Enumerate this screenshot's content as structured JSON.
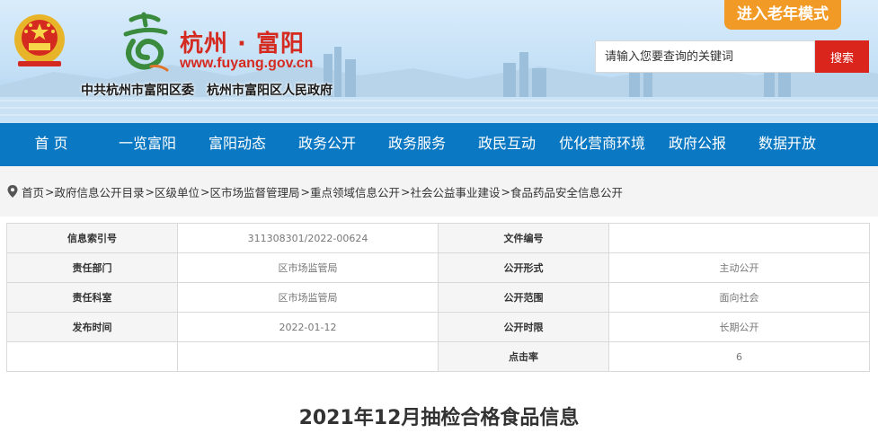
{
  "header": {
    "site_title": "杭州 · 富阳",
    "site_url": "www.fuyang.gov.cn",
    "logo_script_text": "富",
    "org_names": [
      "中共杭州市富阳区委",
      "杭州市富阳区人民政府"
    ],
    "elder_mode_label": "进入老年模式",
    "search_placeholder": "请输入您要查询的关键词",
    "search_button_label": "搜索",
    "colors": {
      "title_red": "#d52a20",
      "elder_orange": "#f19a25",
      "search_red": "#d9251c"
    }
  },
  "nav": {
    "color": "#0a78c2",
    "items": [
      {
        "label": "首 页"
      },
      {
        "label": "一览富阳"
      },
      {
        "label": "富阳动态"
      },
      {
        "label": "政务公开"
      },
      {
        "label": "政务服务"
      },
      {
        "label": "政民互动"
      },
      {
        "label": "优化营商环境"
      },
      {
        "label": "政府公报"
      },
      {
        "label": "数据开放"
      }
    ]
  },
  "breadcrumb": {
    "icon": "location-pin-icon",
    "items": [
      "首页",
      "政府信息公开目录",
      "区级单位",
      "区市场监督管理局",
      "重点领域信息公开",
      "社会公益事业建设",
      "食品药品安全信息公开"
    ],
    "separator": ">"
  },
  "info_table": {
    "rows": [
      {
        "k1": "信息索引号",
        "v1": "311308301/2022-00624",
        "k2": "文件编号",
        "v2": ""
      },
      {
        "k1": "责任部门",
        "v1": "区市场监管局",
        "k2": "公开形式",
        "v2": "主动公开"
      },
      {
        "k1": "责任科室",
        "v1": "区市场监管局",
        "k2": "公开范围",
        "v2": "面向社会"
      },
      {
        "k1": "发布时间",
        "v1": "2022-01-12",
        "k2": "公开时限",
        "v2": "长期公开"
      },
      {
        "k1": "",
        "v1": "",
        "k2": "点击率",
        "v2": "6"
      }
    ]
  },
  "article": {
    "title": "2021年12月抽检合格食品信息"
  }
}
